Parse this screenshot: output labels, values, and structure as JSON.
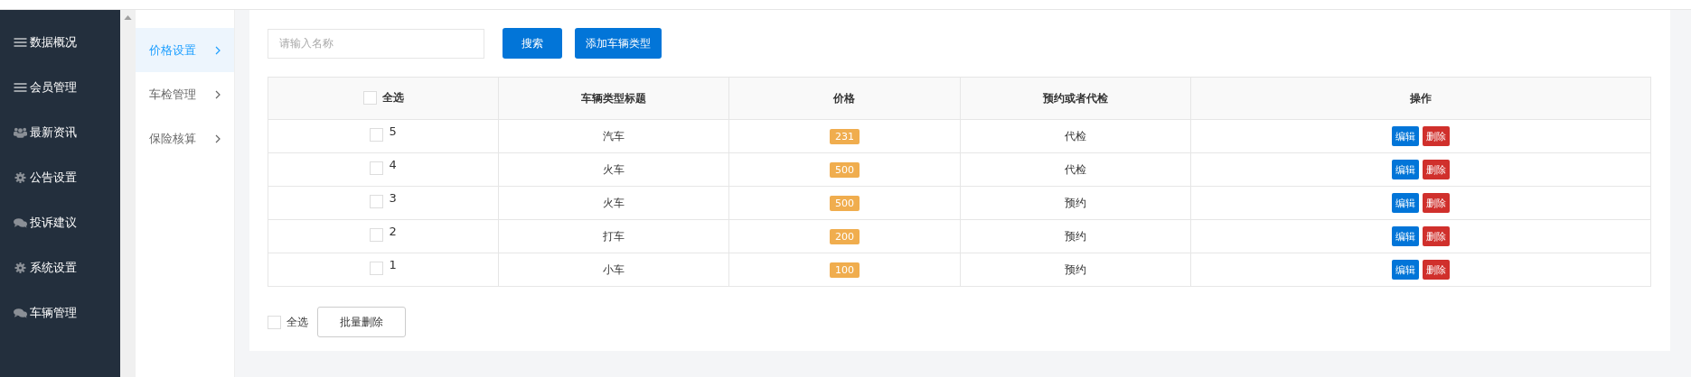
{
  "sidebar": {
    "items": [
      {
        "label": "数据概况",
        "selected": false
      },
      {
        "label": "会员管理",
        "selected": false
      },
      {
        "label": "最新资讯",
        "selected": false
      },
      {
        "label": "公告设置",
        "selected": false
      },
      {
        "label": "投诉建议",
        "selected": false
      },
      {
        "label": "系统设置",
        "selected": false
      },
      {
        "label": "车辆管理",
        "selected": false
      }
    ]
  },
  "subnav": {
    "items": [
      {
        "label": "价格设置",
        "selected": true
      },
      {
        "label": "车检管理",
        "selected": false
      },
      {
        "label": "保险核算",
        "selected": false
      }
    ]
  },
  "toolbar": {
    "search": {
      "placeholder": "请输入名称"
    },
    "search_button": "搜索",
    "add_button": "添加车辆类型"
  },
  "table": {
    "select_all": {
      "label": "全选",
      "checked": false
    },
    "columns": [
      "车辆类型标题",
      "价格",
      "预约或者代检",
      "操作"
    ],
    "rows": [
      {
        "id": "5",
        "checked": false,
        "title": "汽车",
        "price": "231",
        "service": "代检",
        "actions": [
          "编辑",
          "删除"
        ]
      },
      {
        "id": "4",
        "checked": false,
        "title": "火车",
        "price": "500",
        "service": "代检",
        "actions": [
          "编辑",
          "删除"
        ]
      },
      {
        "id": "3",
        "checked": false,
        "title": "火车",
        "price": "500",
        "service": "预约",
        "actions": [
          "编辑",
          "删除"
        ]
      },
      {
        "id": "2",
        "checked": false,
        "title": "打车",
        "price": "200",
        "service": "预约",
        "actions": [
          "编辑",
          "删除"
        ]
      },
      {
        "id": "1",
        "checked": false,
        "title": "小车",
        "price": "100",
        "service": "预约",
        "actions": [
          "编辑",
          "删除"
        ]
      }
    ]
  },
  "footer": {
    "select_all": {
      "label": "全选",
      "checked": false
    },
    "batch_delete": "批量删除"
  }
}
